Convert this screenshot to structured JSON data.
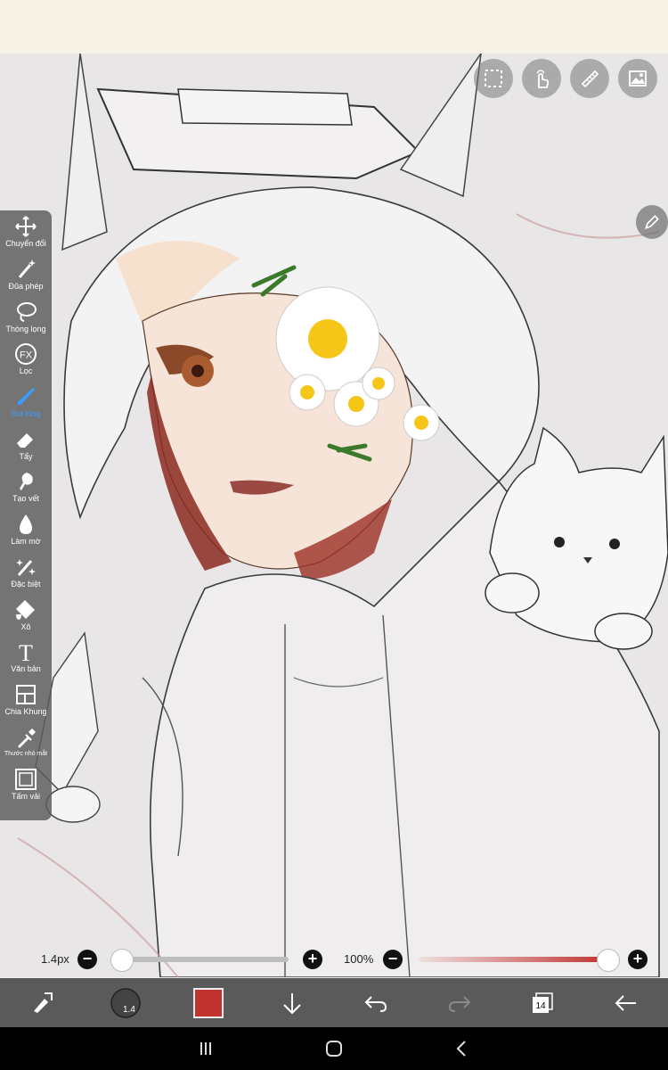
{
  "top_toolbar": {
    "buttons": [
      {
        "icon": "selection-icon"
      },
      {
        "icon": "hand-touch-icon"
      },
      {
        "icon": "ruler-icon"
      },
      {
        "icon": "image-icon"
      }
    ]
  },
  "side_tools": [
    {
      "label": "Chuyển đổi",
      "icon": "move-icon"
    },
    {
      "label": "Đũa phép",
      "icon": "magic-wand-icon"
    },
    {
      "label": "Thòng lọng",
      "icon": "lasso-icon"
    },
    {
      "label": "Lọc",
      "icon": "fx-icon",
      "glyph": "FX"
    },
    {
      "label": "Bút lông",
      "icon": "brush-icon",
      "active": true
    },
    {
      "label": "Tẩy",
      "icon": "eraser-icon"
    },
    {
      "label": "Tạo vết",
      "icon": "smudge-icon"
    },
    {
      "label": "Làm mờ",
      "icon": "blur-drop-icon"
    },
    {
      "label": "Đặc biệt",
      "icon": "special-brush-icon"
    },
    {
      "label": "Xô",
      "icon": "bucket-icon"
    },
    {
      "label": "Văn bản",
      "icon": "text-icon",
      "glyph": "T"
    },
    {
      "label": "Chia Khung",
      "icon": "frame-divider-icon"
    },
    {
      "label": "Thước nhỏ mắt",
      "icon": "eyedropper-icon"
    },
    {
      "label": "Tấm vải",
      "icon": "canvas-icon"
    }
  ],
  "brush_size": {
    "label": "1.4px",
    "value_fraction": 0.0,
    "minus": "−",
    "plus": "+"
  },
  "opacity": {
    "label": "100%",
    "value_fraction": 1.0,
    "minus": "−",
    "plus": "+"
  },
  "bottom_bar": {
    "brush_preview_value": "1.4",
    "current_color": "#c0332f",
    "layer_count": "14"
  },
  "colors": {
    "accent": "#3a9cff",
    "toolbar_bg": "#5a5a5a",
    "sidebar_bg": "#5a5a5a"
  }
}
